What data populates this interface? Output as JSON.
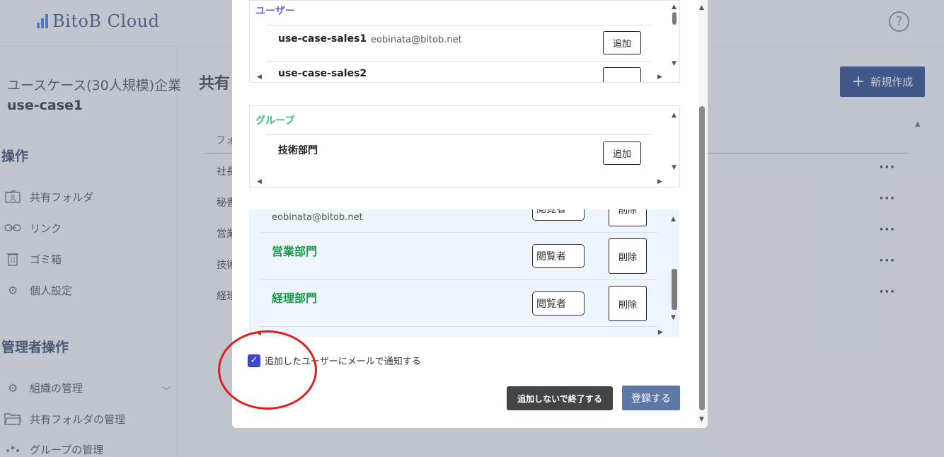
{
  "app": {
    "logo_text": "BitoB Cloud",
    "help_symbol": "?"
  },
  "sidebar": {
    "org_name": "ユースケース(30人規模)企業",
    "org_id": "use-case1",
    "operations_title": "操作",
    "operations": [
      {
        "label": "共有フォルダ",
        "icon": "shared-folder-icon"
      },
      {
        "label": "リンク",
        "icon": "link-icon"
      },
      {
        "label": "ゴミ箱",
        "icon": "trash-icon"
      },
      {
        "label": "個人設定",
        "icon": "gear-icon"
      }
    ],
    "admin_title": "管理者操作",
    "admin": [
      {
        "label": "組織の管理",
        "icon": "gear-icon"
      },
      {
        "label": "共有フォルダの管理",
        "icon": "folder-icon"
      },
      {
        "label": "グループの管理",
        "icon": "group-icon"
      }
    ]
  },
  "main": {
    "title": "共有",
    "new_button": "新規作成",
    "column_header": "フォ",
    "rows": [
      "社長",
      "秘書",
      "営業",
      "技術",
      "経理"
    ],
    "row_menu": "···"
  },
  "modal": {
    "users_title": "ユーザー",
    "users": [
      {
        "name": "use-case-sales1",
        "email": "eobinata@bitob.net",
        "add_label": "追加"
      }
    ],
    "groups_title": "グループ",
    "groups": [
      {
        "name": "技術部門",
        "add_label": "追加"
      }
    ],
    "partial_user_name": "use-case-sales2",
    "members": [
      {
        "type": "user",
        "email": "eobinata@bitob.net",
        "role": "閲覧者",
        "delete_label": "削除"
      },
      {
        "type": "group",
        "name": "営業部門",
        "role": "閲覧者",
        "delete_label": "削除"
      },
      {
        "type": "group",
        "name": "経理部門",
        "role": "閲覧者",
        "delete_label": "削除"
      }
    ],
    "notify_label": "追加したユーザーにメールで通知する",
    "notify_checked": true,
    "exit_button": "追加しないで終了する",
    "submit_button": "登録する"
  },
  "colors": {
    "accent": "#4147d5",
    "group_green": "#1e9a4a",
    "users_title": "#6b63e0",
    "groups_title": "#33c27a",
    "annotation_red": "#e21d1d"
  }
}
